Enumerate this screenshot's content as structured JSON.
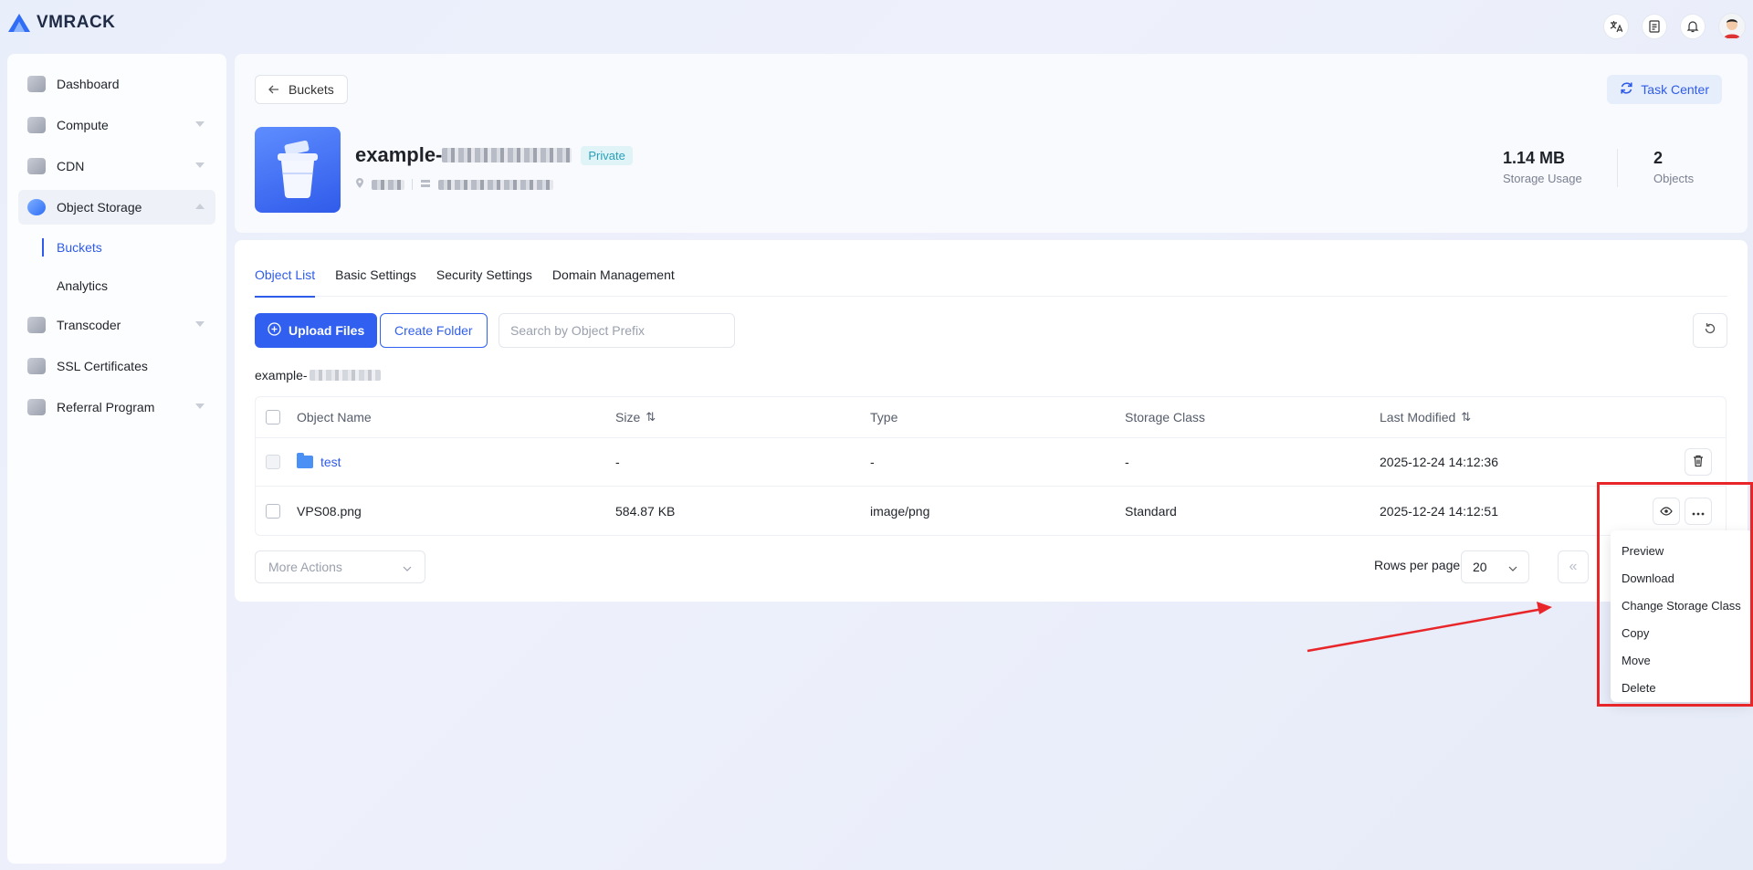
{
  "app": {
    "logo_text": "VMRACK"
  },
  "topbar": {
    "icons": [
      "translate-icon",
      "document-icon",
      "bell-icon",
      "avatar"
    ]
  },
  "sidebar": {
    "items": [
      {
        "label": "Dashboard",
        "icon": "dashboard-icon",
        "expandable": false
      },
      {
        "label": "Compute",
        "icon": "compute-icon",
        "expandable": true
      },
      {
        "label": "CDN",
        "icon": "cdn-icon",
        "expandable": true
      },
      {
        "label": "Object Storage",
        "icon": "object-storage-icon",
        "expandable": true,
        "expanded": true,
        "active": true
      },
      {
        "label": "Transcoder",
        "icon": "transcoder-icon",
        "expandable": true
      },
      {
        "label": "SSL Certificates",
        "icon": "ssl-icon",
        "expandable": false
      },
      {
        "label": "Referral Program",
        "icon": "referral-icon",
        "expandable": true
      }
    ],
    "sub_items": [
      {
        "label": "Buckets",
        "active": true
      },
      {
        "label": "Analytics",
        "active": false
      }
    ]
  },
  "header": {
    "back_label": "Buckets",
    "task_center_label": "Task Center",
    "bucket_name_prefix": "example-",
    "visibility_badge": "Private",
    "stats": [
      {
        "value": "1.14 MB",
        "label": "Storage Usage"
      },
      {
        "value": "2",
        "label": "Objects"
      }
    ]
  },
  "main": {
    "tabs": [
      "Object List",
      "Basic Settings",
      "Security Settings",
      "Domain Management"
    ],
    "active_tab": "Object List",
    "upload_label": "Upload Files",
    "create_folder_label": "Create Folder",
    "search_placeholder": "Search by Object Prefix",
    "path_prefix": "example-",
    "table": {
      "columns": [
        "Object Name",
        "Size",
        "Type",
        "Storage Class",
        "Last Modified"
      ],
      "rows": [
        {
          "name": "test",
          "is_folder": true,
          "size": "-",
          "type": "-",
          "storage_class": "-",
          "last_modified": "2025-12-24 14:12:36"
        },
        {
          "name": "VPS08.png",
          "is_folder": false,
          "size": "584.87 KB",
          "type": "image/png",
          "storage_class": "Standard",
          "last_modified": "2025-12-24 14:12:51"
        }
      ]
    },
    "more_actions_label": "More Actions",
    "rows_per_page_label": "Rows per page",
    "rows_per_page_value": "20"
  },
  "context_menu": {
    "items": [
      "Preview",
      "Download",
      "Change Storage Class",
      "Copy",
      "Move",
      "Delete"
    ]
  },
  "colors": {
    "accent": "#3160f0",
    "annotation": "#e8262a"
  }
}
